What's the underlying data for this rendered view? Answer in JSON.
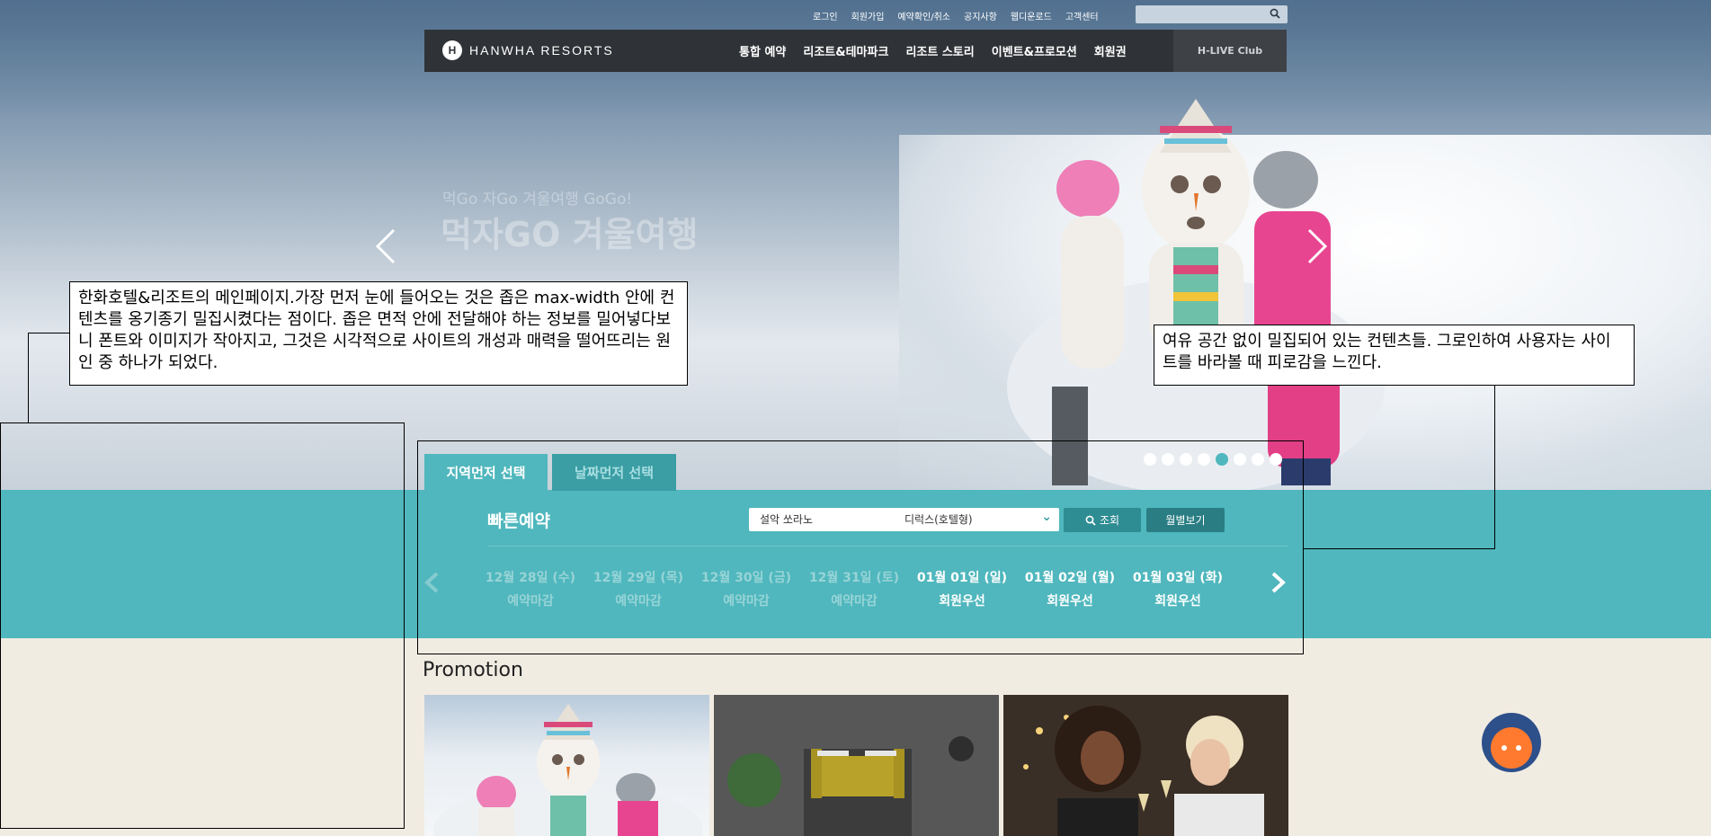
{
  "util_links": [
    "로그인",
    "회원가입",
    "예약확인/취소",
    "공지사항",
    "웹디운로드",
    "고객센터"
  ],
  "icons": {
    "search": "search-icon",
    "prev": "chevron-left-icon",
    "next": "chevron-right-icon",
    "chatbot": "chatbot-icon",
    "dropdown": "chevron-down-icon"
  },
  "brand": {
    "name": "HANWHA RESORTS",
    "mark": "H"
  },
  "menu": [
    "통합 예약",
    "리조트&테마파크",
    "리조트 스토리",
    "이벤트&프로모션",
    "회원권"
  ],
  "hlive": "H-LIVE Club",
  "hero": {
    "subtitle": "먹Go 자Go 겨울여행 GoGo!",
    "title": "먹자GO 겨울여행"
  },
  "annotations": {
    "left": "한화호텔&리조트의 메인페이지.가장 먼저 눈에 들어오는 것은 좁은 max-width 안에 컨텐츠를 옹기종기 밀집시켰다는 점이다. 좁은 면적 안에 전달해야 하는 정보를 밀어넣다보니 폰트와 이미지가 작아지고, 그것은 시각적으로 사이트의 개성과 매력을 떨어뜨리는 원인 중 하나가 되었다.",
    "right": "여유 공간 없이 밀집되어 있는 컨텐츠들. 그로인하여 사용자는 사이트를 바라볼 때 피로감을 느낀다."
  },
  "booking": {
    "tab_region": "지역먼저 선택",
    "tab_date": "날짜먼저 선택",
    "quick_label": "빠른예약",
    "resort_select": "설악 쏘라노",
    "room_select": "디럭스(호텔형)",
    "search_button": "조회",
    "monthly_button": "월별보기",
    "slide_count": 8,
    "active_slide": 5,
    "dates": [
      {
        "date": "12월 28일 (수)",
        "status": "예약마감",
        "state": "closed"
      },
      {
        "date": "12월 29일 (목)",
        "status": "예약마감",
        "state": "closed"
      },
      {
        "date": "12월 30일 (금)",
        "status": "예약마감",
        "state": "closed"
      },
      {
        "date": "12월 31일 (토)",
        "status": "예약마감",
        "state": "closed"
      },
      {
        "date": "01월 01일 (일)",
        "status": "회원우선",
        "state": "open"
      },
      {
        "date": "01월 02일 (월)",
        "status": "회원우선",
        "state": "open"
      },
      {
        "date": "01월 03일 (화)",
        "status": "회원우선",
        "state": "open"
      }
    ]
  },
  "promotion": {
    "title": "Promotion"
  },
  "colors": {
    "teal": "#4fb7bd",
    "teal_dark": "#3a9ea4",
    "nav": "#2f3236",
    "page_bg": "#f1ece2"
  }
}
